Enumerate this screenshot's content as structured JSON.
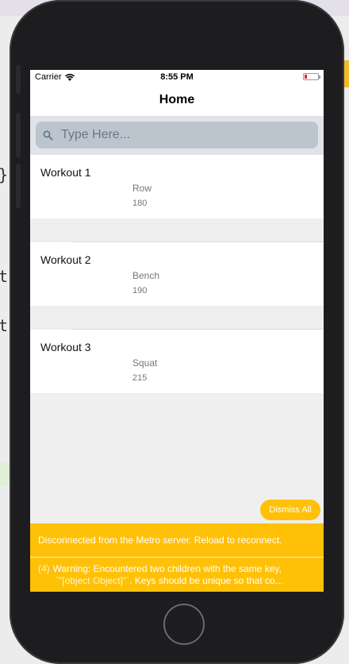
{
  "status_bar": {
    "carrier": "Carrier",
    "time": "8:55 PM"
  },
  "nav": {
    "title": "Home"
  },
  "search": {
    "placeholder": "Type Here..."
  },
  "workouts": [
    {
      "title": "Workout 1",
      "exercise": "Row",
      "weight": "180"
    },
    {
      "title": "Workout 2",
      "exercise": "Bench",
      "weight": "190"
    },
    {
      "title": "Workout 3",
      "exercise": "Squat",
      "weight": "215"
    }
  ],
  "dismiss_label": "Dismiss All",
  "banners": {
    "disconnected": "Disconnected from the Metro server. Reload to reconnect.",
    "warning_count": "(4)",
    "warning_line1": "Warning: Encountered two children with the same key,",
    "warning_key": "`\"[object Object]\"`",
    "warning_line2_rest": ". Keys should be unique so that co..."
  },
  "background_code": [
    "}",
    "t)",
    "t)"
  ],
  "colors": {
    "accent": "#ffc107",
    "search_bg": "#bcc5cd",
    "battery_low": "#e0262b"
  }
}
